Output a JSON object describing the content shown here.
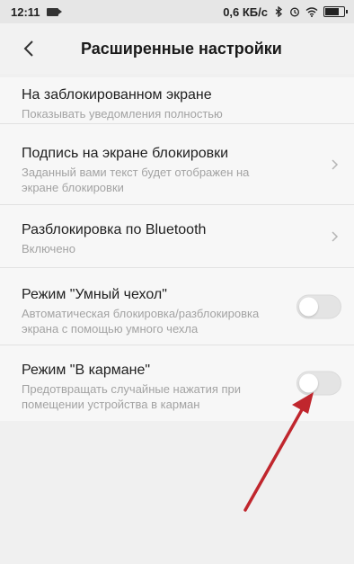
{
  "status_bar": {
    "time": "12:11",
    "network_speed": "0,6 КБ/с",
    "icons": [
      "video-camera-icon",
      "bluetooth-icon",
      "alarm-icon",
      "wifi-icon",
      "battery-icon"
    ]
  },
  "header": {
    "back_icon": "chevron-left-icon",
    "title": "Расширенные настройки"
  },
  "settings": [
    {
      "title": "На заблокированном экране",
      "subtitle": "Показывать уведомления полностью",
      "control": "none"
    },
    {
      "title": "Подпись на экране блокировки",
      "subtitle": "Заданный вами текст будет отображен на экране блокировки",
      "control": "chevron"
    },
    {
      "title": "Разблокировка по Bluetooth",
      "subtitle": "Включено",
      "control": "chevron"
    },
    {
      "title": "Режим \"Умный чехол\"",
      "subtitle": "Автоматическая блокировка/разблокировка экрана с помощью умного чехла",
      "control": "toggle",
      "enabled": false
    },
    {
      "title": "Режим \"В кармане\"",
      "subtitle": "Предотвращать случайные нажатия при помещении устройства в карман",
      "control": "toggle",
      "enabled": false
    }
  ],
  "annotation_color": "#c0262d"
}
